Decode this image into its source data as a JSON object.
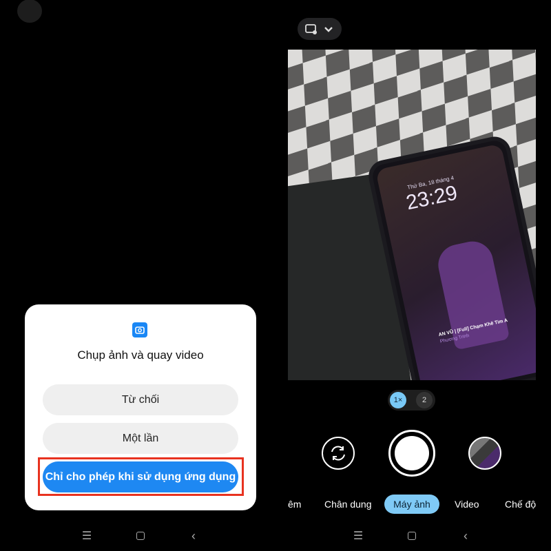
{
  "left_screen": {
    "dialog": {
      "icon": "camera-icon",
      "title": "Chụp ảnh và quay video",
      "buttons": [
        "Từ chối",
        "Một lần",
        "Chỉ cho phép khi sử dụng ứng dụng"
      ],
      "highlight_color": "#e8321f",
      "accent_color": "#1e88f2"
    },
    "nav": [
      "menu-icon",
      "home-icon",
      "back-icon"
    ]
  },
  "right_screen": {
    "top_pill": {
      "icons": [
        "camera-settings-icon",
        "chevron-down-icon"
      ]
    },
    "viewfinder": {
      "lock_date": "Thứ Ba, 18 tháng 4",
      "lock_time": "23:29",
      "song": "AN VŨ | [Full] Chạm Khẽ Tim A",
      "artist": "Phương Trinh"
    },
    "zoom": {
      "options": [
        "1×",
        "2"
      ],
      "selected": "1×"
    },
    "controls": [
      "flip-camera-icon",
      "shutter-button",
      "gallery-thumbnail"
    ],
    "modes": [
      "êm",
      "Chân dung",
      "Máy ảnh",
      "Video",
      "Chế độ"
    ],
    "selected_mode": "Máy ảnh",
    "accent_color": "#7fcaf6",
    "nav": [
      "menu-icon",
      "home-icon",
      "back-icon"
    ]
  }
}
